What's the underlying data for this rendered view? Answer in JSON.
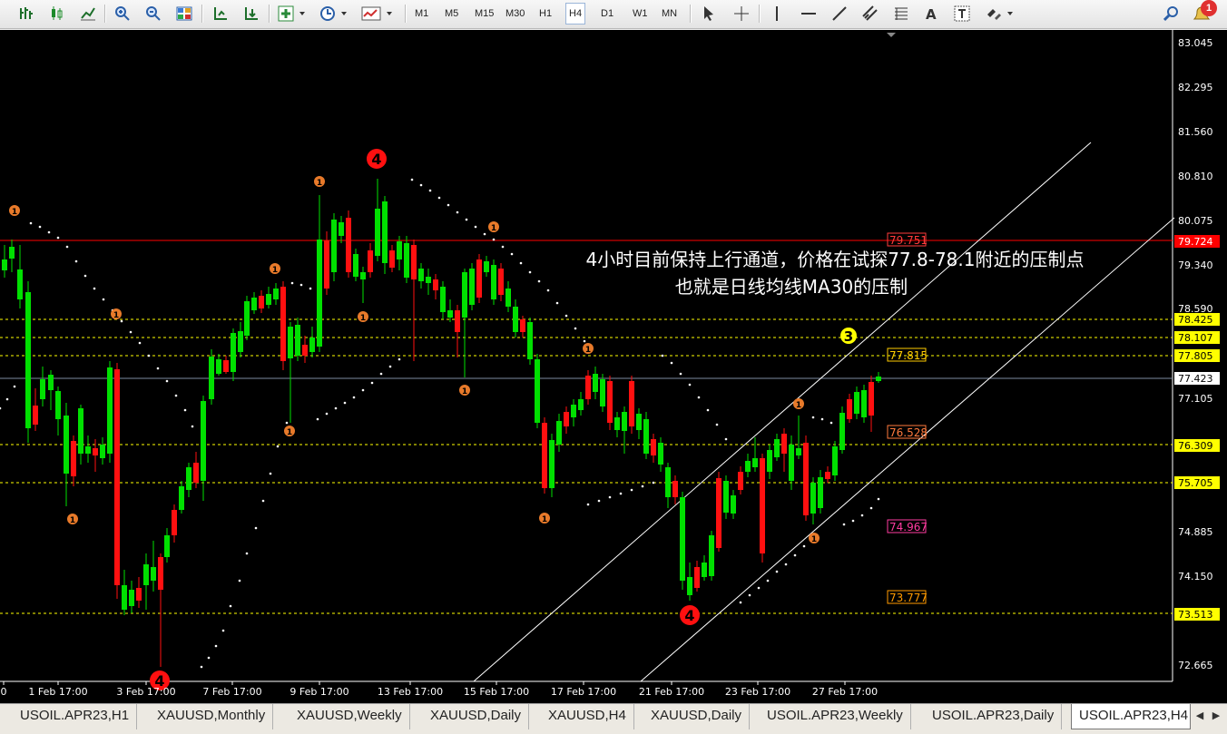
{
  "toolbar": {
    "timeframes": [
      "M1",
      "M5",
      "M15",
      "M30",
      "H1",
      "H4",
      "D1",
      "W1",
      "MN"
    ],
    "active_timeframe": "H4",
    "notification_count": "1"
  },
  "chart": {
    "price_axis": [
      "83.045",
      "82.295",
      "81.560",
      "80.810",
      "80.075",
      "79.340",
      "78.590",
      "77.105",
      "74.885",
      "74.150",
      "72.665"
    ],
    "price_tags": [
      {
        "text": "79.724",
        "bg": "#ff0000",
        "fg": "#ffffff"
      },
      {
        "text": "78.425",
        "bg": "#ffff00",
        "fg": "#000000"
      },
      {
        "text": "78.107",
        "bg": "#ffff00",
        "fg": "#000000"
      },
      {
        "text": "77.805",
        "bg": "#ffff00",
        "fg": "#000000"
      },
      {
        "text": "77.423",
        "bg": "#ffffff",
        "fg": "#000000"
      },
      {
        "text": "76.309",
        "bg": "#ffff00",
        "fg": "#000000"
      },
      {
        "text": "75.705",
        "bg": "#ffff00",
        "fg": "#000000"
      },
      {
        "text": "73.513",
        "bg": "#ffff00",
        "fg": "#000000"
      }
    ],
    "level_labels": [
      {
        "text": "79.751",
        "color": "#ff3b3b"
      },
      {
        "text": "77.815",
        "color": "#ffcc00"
      },
      {
        "text": "76.528",
        "color": "#ff7a3d"
      },
      {
        "text": "74.967",
        "color": "#ff3ba0"
      },
      {
        "text": "73.777",
        "color": "#ff9a00"
      }
    ],
    "time_axis": [
      "0",
      "1 Feb 17:00",
      "3 Feb 17:00",
      "7 Feb 17:00",
      "9 Feb 17:00",
      "13 Feb 17:00",
      "15 Feb 17:00",
      "17 Feb 17:00",
      "21 Feb 17:00",
      "23 Feb 17:00",
      "27 Feb 17:00"
    ],
    "annotation_line1": "4小时目前保持上行通道，价格在试探77.8-78.1附近的压制点",
    "annotation_line2": "也就是日线均线MA30的压制",
    "wave_labels": [
      "4",
      "4",
      "4",
      "3"
    ],
    "minor_label": "1",
    "colors": {
      "bull": "#00e000",
      "bear": "#ff1010",
      "grid": "#ffff00",
      "resistance": "#ff0000",
      "axis_text": "#ffffff",
      "background": "#000000"
    }
  },
  "tabs": [
    {
      "label": "USOIL.APR23,H1",
      "active": false
    },
    {
      "label": "XAUUSD,Monthly",
      "active": false
    },
    {
      "label": "XAUUSD,Weekly",
      "active": false
    },
    {
      "label": "XAUUSD,Daily",
      "active": false
    },
    {
      "label": "XAUUSD,H4",
      "active": false
    },
    {
      "label": "XAUUSD,Daily",
      "active": false
    },
    {
      "label": "USOIL.APR23,Weekly",
      "active": false
    },
    {
      "label": "USOIL.APR23,Daily",
      "active": false
    },
    {
      "label": "USOIL.APR23,H4",
      "active": true
    }
  ]
}
